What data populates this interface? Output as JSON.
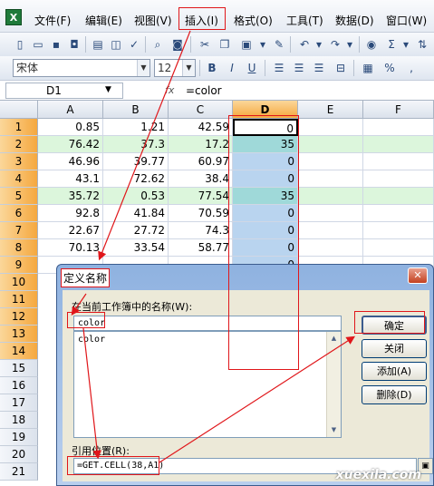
{
  "app_icon": "X",
  "menu": [
    "文件(F)",
    "编辑(E)",
    "视图(V)",
    "插入(I)",
    "格式(O)",
    "工具(T)",
    "数据(D)",
    "窗口(W)"
  ],
  "toolbar_font": {
    "name": "宋体",
    "size": "12",
    "bold": "B",
    "italic": "I",
    "underline": "U",
    "percent": "%",
    "comma": ","
  },
  "formula_bar": {
    "cell_ref": "D1",
    "fx": "fx",
    "formula": "=color"
  },
  "columns": [
    "A",
    "B",
    "C",
    "D",
    "E",
    "F"
  ],
  "row_numbers": [
    "1",
    "2",
    "3",
    "4",
    "5",
    "6",
    "7",
    "8",
    "9",
    "10",
    "11",
    "12",
    "13",
    "14",
    "15",
    "16",
    "17",
    "18",
    "19",
    "20",
    "21"
  ],
  "rows": [
    {
      "a": "0.85",
      "b": "1.21",
      "c": "42.59",
      "d": "0",
      "highlight": false
    },
    {
      "a": "76.42",
      "b": "37.3",
      "c": "17.2",
      "d": "35",
      "highlight": true
    },
    {
      "a": "46.96",
      "b": "39.77",
      "c": "60.97",
      "d": "0",
      "highlight": false
    },
    {
      "a": "43.1",
      "b": "72.62",
      "c": "38.4",
      "d": "0",
      "highlight": false
    },
    {
      "a": "35.72",
      "b": "0.53",
      "c": "77.54",
      "d": "35",
      "highlight": true
    },
    {
      "a": "92.8",
      "b": "41.84",
      "c": "70.59",
      "d": "0",
      "highlight": false
    },
    {
      "a": "22.67",
      "b": "27.72",
      "c": "74.3",
      "d": "0",
      "highlight": false
    },
    {
      "a": "70.13",
      "b": "33.54",
      "c": "58.77",
      "d": "0",
      "highlight": false
    },
    {
      "a": "",
      "b": "",
      "c": "",
      "d": "0",
      "highlight": false
    }
  ],
  "dialog": {
    "title": "定义名称",
    "close": "✕",
    "names_label": "在当前工作簿中的名称(W):",
    "name_value": "color",
    "list_items": [
      "color"
    ],
    "refers_label": "引用位置(R):",
    "refers_value": "=GET.CELL(38,A1)",
    "buttons": {
      "ok": "确定",
      "close": "关闭",
      "add": "添加(A)",
      "delete": "删除(D)"
    }
  },
  "watermark": "xuexila.com"
}
